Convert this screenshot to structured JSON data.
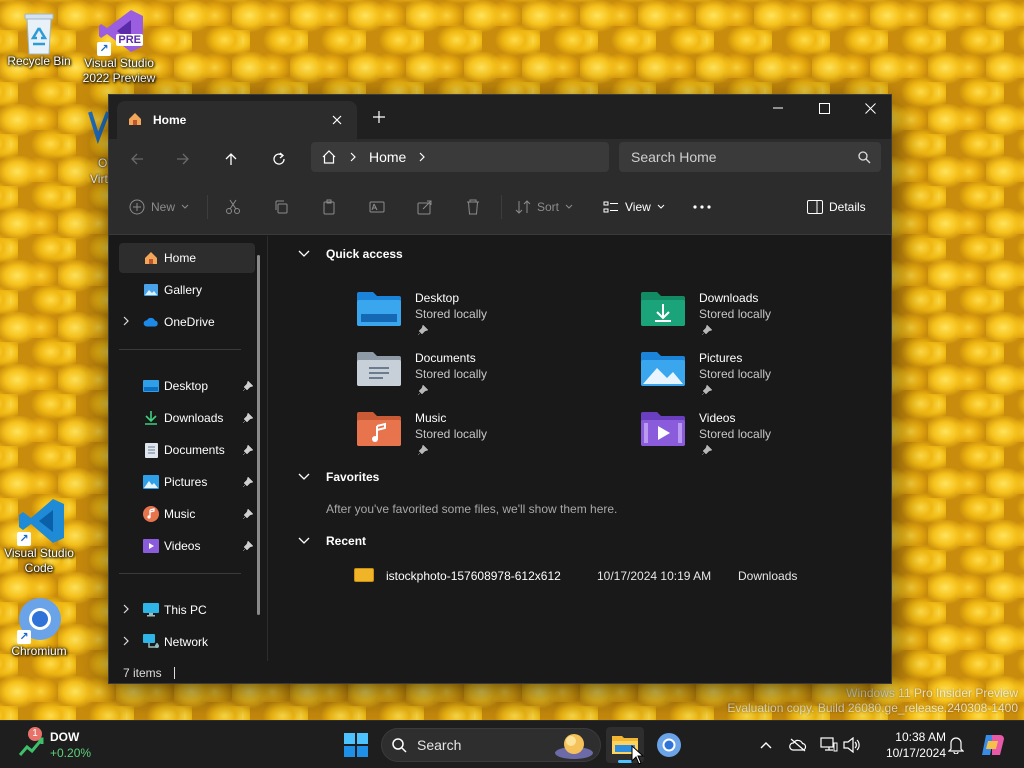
{
  "desktop": {
    "icons": [
      {
        "label": "Recycle Bin"
      },
      {
        "label": "Visual Studio 2022 Preview",
        "badge": "PRE"
      },
      {
        "label": "Visual Studio Code"
      },
      {
        "label": "Chromium"
      }
    ],
    "partial_icon_text": [
      "O",
      "Virt"
    ]
  },
  "watermark": {
    "line1": "Windows 11 Pro Insider Preview",
    "line2": "Evaluation copy. Build 26080.ge_release.240308-1400"
  },
  "explorer": {
    "tab_title": "Home",
    "address": {
      "crumb": "Home"
    },
    "search_placeholder": "Search Home",
    "commands": {
      "new": "New",
      "sort": "Sort",
      "view": "View",
      "details": "Details"
    },
    "nav": {
      "home": "Home",
      "gallery": "Gallery",
      "onedrive": "OneDrive",
      "desktop": "Desktop",
      "downloads": "Downloads",
      "documents": "Documents",
      "pictures": "Pictures",
      "music": "Music",
      "videos": "Videos",
      "thispc": "This PC",
      "network": "Network"
    },
    "quick_access": {
      "title": "Quick access",
      "items": [
        {
          "name": "Desktop",
          "status": "Stored locally"
        },
        {
          "name": "Downloads",
          "status": "Stored locally"
        },
        {
          "name": "Documents",
          "status": "Stored locally"
        },
        {
          "name": "Pictures",
          "status": "Stored locally"
        },
        {
          "name": "Music",
          "status": "Stored locally"
        },
        {
          "name": "Videos",
          "status": "Stored locally"
        }
      ]
    },
    "favorites": {
      "title": "Favorites",
      "empty_text": "After you've favorited some files, we'll show them here."
    },
    "recent": {
      "title": "Recent",
      "items": [
        {
          "name": "istockphoto-157608978-612x612",
          "date": "10/17/2024 10:19 AM",
          "location": "Downloads"
        }
      ]
    },
    "status": {
      "items": "7 items"
    }
  },
  "taskbar": {
    "widget": {
      "name": "DOW",
      "value": "+0.20%",
      "badge": "1"
    },
    "search_placeholder": "Search",
    "clock": {
      "time": "10:38 AM",
      "date": "10/17/2024"
    }
  },
  "colors": {
    "folder_blue": "#3d8fe6",
    "download_teal": "#1ba37a",
    "music_orange": "#e8744e",
    "video_purple": "#8a5cdb",
    "accent": "#4cc2ff"
  }
}
